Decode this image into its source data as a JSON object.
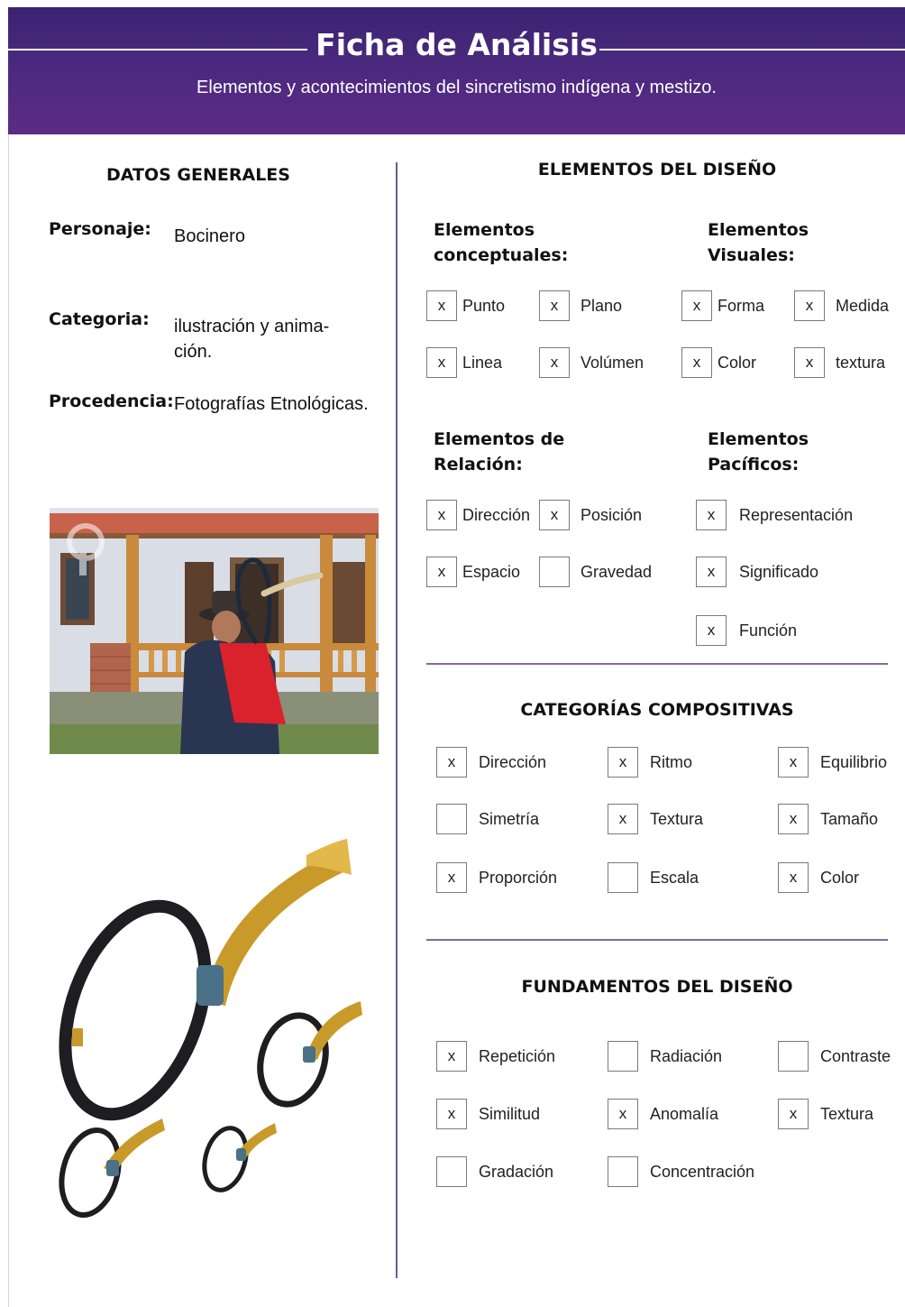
{
  "header": {
    "title": "Ficha de Análisis",
    "subtitle": "Elementos y acontecimientos del sincretismo indígena y mestizo."
  },
  "general": {
    "heading": "DATOS GENERALES",
    "personaje_label": "Personaje:",
    "personaje_value": "Bocinero",
    "categoria_label": "Categoria:",
    "categoria_value_l1": "ilustración y anima-",
    "categoria_value_l2": "ción.",
    "procedencia_label": "Procedencia:",
    "procedencia_value": "Fotografías Etnológicas."
  },
  "design_elements": {
    "heading": "ELEMENTOS DEL DISEÑO",
    "conceptual_l1": "Elementos",
    "conceptual_l2": "conceptuales:",
    "visual_l1": "Elementos",
    "visual_l2": "Visuales:",
    "relation_l1": "Elementos de",
    "relation_l2": "Relación:",
    "practical_l1": "Elementos",
    "practical_l2": "Pacíficos:",
    "conceptual_items": [
      {
        "label": "Punto",
        "mark": "x"
      },
      {
        "label": "Plano",
        "mark": "x"
      },
      {
        "label": "Linea",
        "mark": "x"
      },
      {
        "label": "Volúmen",
        "mark": "x"
      }
    ],
    "visual_items": [
      {
        "label": "Forma",
        "mark": "x"
      },
      {
        "label": "Medida",
        "mark": "x"
      },
      {
        "label": "Color",
        "mark": "x"
      },
      {
        "label": "textura",
        "mark": "x"
      }
    ],
    "relation_items": [
      {
        "label": "Dirección",
        "mark": "x"
      },
      {
        "label": "Posición",
        "mark": "x"
      },
      {
        "label": "Espacio",
        "mark": "x"
      },
      {
        "label": "Gravedad",
        "mark": ""
      }
    ],
    "practical_items": [
      {
        "label": "Representación",
        "mark": "x"
      },
      {
        "label": "Significado",
        "mark": "x"
      },
      {
        "label": "Función",
        "mark": "x"
      }
    ]
  },
  "compositive": {
    "heading": "CATEGORÍAS COMPOSITIVAS",
    "items": [
      {
        "label": "Dirección",
        "mark": "x"
      },
      {
        "label": "Ritmo",
        "mark": "x"
      },
      {
        "label": "Equilibrio",
        "mark": "x"
      },
      {
        "label": "Simetría",
        "mark": ""
      },
      {
        "label": "Textura",
        "mark": "x"
      },
      {
        "label": "Tamaño",
        "mark": "x"
      },
      {
        "label": "Proporción",
        "mark": "x"
      },
      {
        "label": "Escala",
        "mark": ""
      },
      {
        "label": "Color",
        "mark": "x"
      }
    ]
  },
  "fundamentals": {
    "heading": "FUNDAMENTOS DEL DISEÑO",
    "items": [
      {
        "label": "Repetición",
        "mark": "x"
      },
      {
        "label": "Radiación",
        "mark": ""
      },
      {
        "label": "Contraste",
        "mark": ""
      },
      {
        "label": "Similitud",
        "mark": "x"
      },
      {
        "label": "Anomalía",
        "mark": "x"
      },
      {
        "label": "Textura",
        "mark": "x"
      },
      {
        "label": "Gradación",
        "mark": ""
      },
      {
        "label": "Concentración",
        "mark": ""
      }
    ]
  }
}
